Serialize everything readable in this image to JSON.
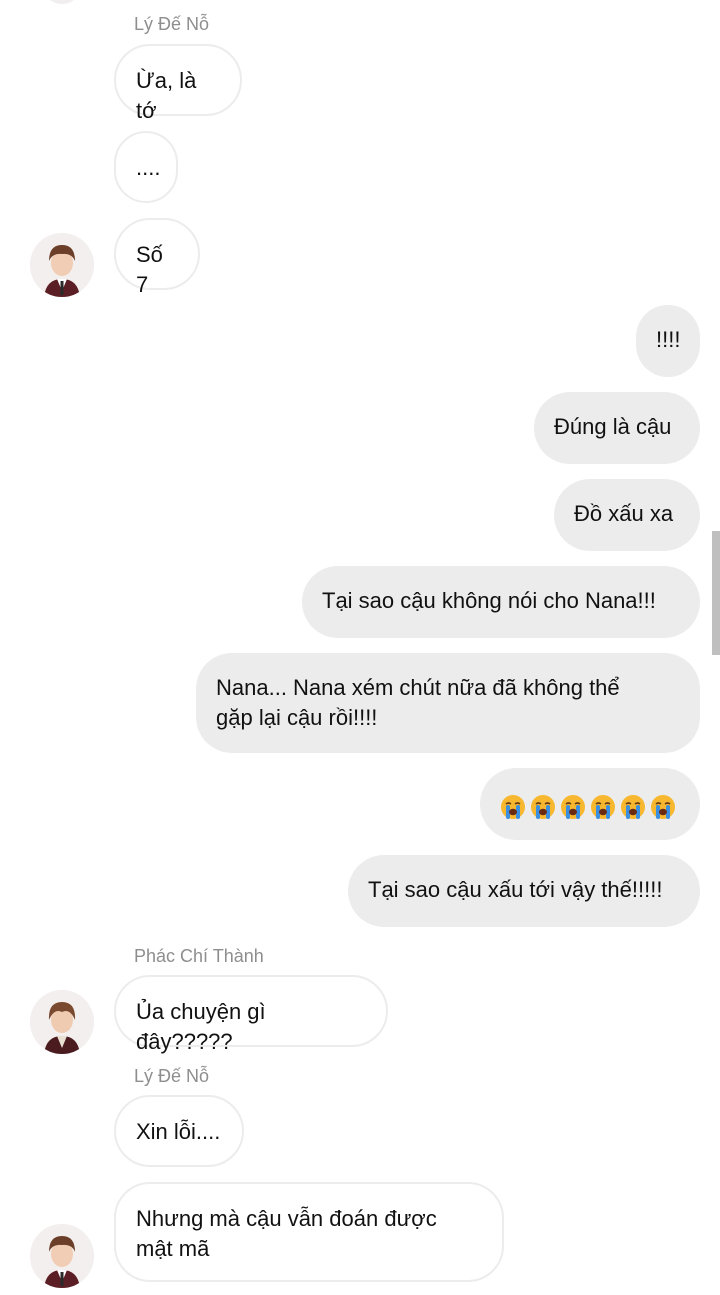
{
  "messages": [
    {
      "sender": "Lý Đế Nỗ",
      "text": "Ừa, là tớ"
    },
    {
      "text": "...."
    },
    {
      "text": "Số 7"
    },
    {
      "text": "!!!!"
    },
    {
      "text": "Đúng là cậu"
    },
    {
      "text": "Đồ xấu xa"
    },
    {
      "text": "Tại sao cậu không nói cho Nana!!!"
    },
    {
      "line1": "Nana... Nana xém chút nữa đã không thể",
      "line2": "gặp lại cậu rồi!!!!"
    },
    {
      "emoji": "loudly-crying-face",
      "count": 6
    },
    {
      "text": "Tại sao cậu xấu tới vậy thế!!!!!"
    },
    {
      "sender": "Phác Chí Thành",
      "text": "Ủa chuyện gì đây?????"
    },
    {
      "sender": "Lý Đế Nỗ",
      "text": "Xin lỗi...."
    },
    {
      "line1": "Nhưng mà cậu vẫn đoán được",
      "line2": "mật mã"
    }
  ],
  "colors": {
    "incoming_bg": "#ffffff",
    "incoming_border": "#ececec",
    "outgoing_bg": "#ececec",
    "sender_text": "#8e8e8e",
    "text": "#111111",
    "emoji_face": "#f7b82f",
    "emoji_tears": "#3b8fe0"
  }
}
